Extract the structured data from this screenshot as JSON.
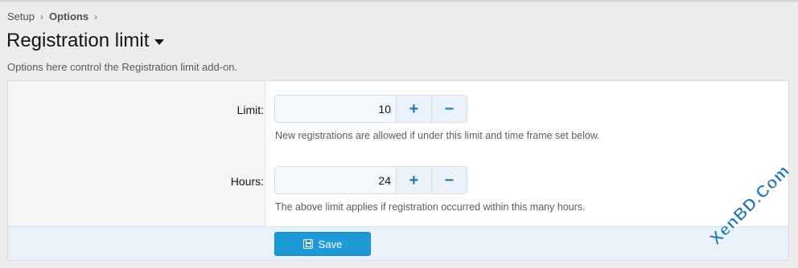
{
  "breadcrumb": {
    "items": [
      "Setup",
      "Options"
    ]
  },
  "page": {
    "title": "Registration limit",
    "description": "Options here control the Registration limit add-on."
  },
  "fields": [
    {
      "label": "Limit:",
      "value": "10",
      "hint": "New registrations are allowed if under this limit and time frame set below."
    },
    {
      "label": "Hours:",
      "value": "24",
      "hint": "The above limit applies if registration occurred within this many hours."
    }
  ],
  "icons": {
    "increment": "+",
    "decrement": "−",
    "separator": "›"
  },
  "footer": {
    "save_label": "Save"
  },
  "watermark": {
    "text": "XenBD.Com"
  },
  "colors": {
    "accent": "#1e9ad6",
    "stepper_text": "#2577b1",
    "watermark": "#1a73b8"
  }
}
